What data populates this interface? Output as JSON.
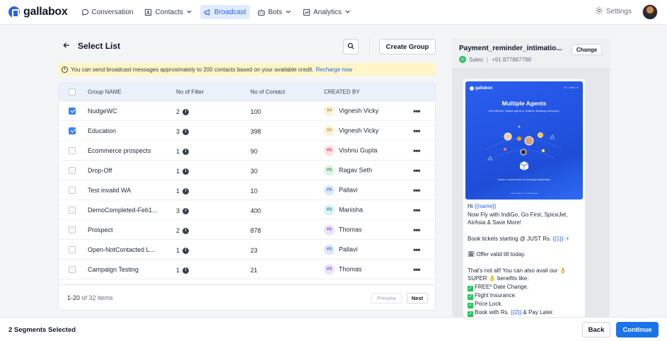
{
  "nav": {
    "logo_text": "gallabox",
    "items": [
      {
        "label": "Conversation",
        "icon": "chat-bubble-icon",
        "active": false,
        "dropdown": false
      },
      {
        "label": "Contacts",
        "icon": "contact-card-icon",
        "active": false,
        "dropdown": true
      },
      {
        "label": "Broadcast",
        "icon": "megaphone-icon",
        "active": true,
        "dropdown": false
      },
      {
        "label": "Bots",
        "icon": "bot-icon",
        "active": false,
        "dropdown": true
      },
      {
        "label": "Analytics",
        "icon": "chart-icon",
        "active": false,
        "dropdown": true
      }
    ],
    "settings_label": "Settings"
  },
  "page": {
    "title": "Select List",
    "create_group_label": "Create Group",
    "notice_text": "You can send broadcast messages approximately to 200 contacts based on your available credit.",
    "notice_link": "Recharge now"
  },
  "table": {
    "headers": {
      "name": "Group NAME",
      "filters": "No of Filter",
      "contacts": "No of Contact",
      "created_by": "CREATED BY"
    },
    "rows": [
      {
        "checked": true,
        "name": "NudgeWC",
        "filters": "2",
        "contacts": "100",
        "initials": "VV",
        "creator": "Vignesh Vicky",
        "badge_bg": "#fdf1d6",
        "badge_fg": "#b7791f"
      },
      {
        "checked": true,
        "name": "Education",
        "filters": "3",
        "contacts": "398",
        "initials": "VV",
        "creator": "Vignesh Vicky",
        "badge_bg": "#fdf1d6",
        "badge_fg": "#b7791f"
      },
      {
        "checked": false,
        "name": "Ecommerce prospects",
        "filters": "1",
        "contacts": "90",
        "initials": "VG",
        "creator": "Vishnu Gupta",
        "badge_bg": "#fde2e4",
        "badge_fg": "#c53030"
      },
      {
        "checked": false,
        "name": "Drop-Off",
        "filters": "1",
        "contacts": "30",
        "initials": "VG",
        "creator": "Ragav Seth",
        "badge_bg": "#dcf5e3",
        "badge_fg": "#2f855a"
      },
      {
        "checked": false,
        "name": "Test invalid WA",
        "filters": "1",
        "contacts": "10",
        "initials": "VG",
        "creator": "Pallavi",
        "badge_bg": "#dde8fb",
        "badge_fg": "#2b6cb0"
      },
      {
        "checked": false,
        "name": "DemoCompleted-Feb1...",
        "filters": "3",
        "contacts": "400",
        "initials": "VG",
        "creator": "Manisha",
        "badge_bg": "#d9f2f7",
        "badge_fg": "#2c7a7b"
      },
      {
        "checked": false,
        "name": "Prospect",
        "filters": "2",
        "contacts": "878",
        "initials": "VG",
        "creator": "Thomas",
        "badge_bg": "#ece3fb",
        "badge_fg": "#6b46c1"
      },
      {
        "checked": false,
        "name": "Open-NotContacted L...",
        "filters": "1",
        "contacts": "23",
        "initials": "VG",
        "creator": "Pallavi",
        "badge_bg": "#dde8fb",
        "badge_fg": "#2b6cb0"
      },
      {
        "checked": false,
        "name": "Campaign Testing",
        "filters": "1",
        "contacts": "21",
        "initials": "VG",
        "creator": "Thomas",
        "badge_bg": "#ece3fb",
        "badge_fg": "#6b46c1"
      }
    ],
    "pager": {
      "range": "1-20",
      "of_text": "of 32 items",
      "prev_label": "Preview",
      "next_label": "Next"
    }
  },
  "template": {
    "name": "Payment_reminder_intimatio...",
    "category": "Sales",
    "phone": "+91 877887788",
    "change_label": "Change",
    "image": {
      "logo_text": "gallabox",
      "nav_text": "1/4 · Invite  >>",
      "title": "Multiple Agents",
      "subtitle": "Add unlimited, multiple agents to Gallabox Whatsapp workspace.",
      "caption": "Create a shared inbox for amazing collaboration",
      "footer": "www.gallabox.com/whatsapp"
    },
    "message": {
      "greet_prefix": "Hi ",
      "var_name": "{{name}}",
      "line_fly": "Now Fly with IndiGo, Go First, SpiceJet, AirAsia & Save More!",
      "book_prefix": "Book tickets starting @ JUST Rs. ",
      "var_1": "{{1}}",
      "book_suffix": " ✈",
      "offer": "🗓 Offer valid till today.",
      "more": "That's not all! You can also avail our 👌 SUPER 👌 benefits like:",
      "b1": "FREE* Date Change.",
      "b2": "Flight Insurance.",
      "b3": "Price Lock.",
      "b4_prefix": "Book with Rs. ",
      "var_2": "{{2}}",
      "b4_suffix": " & Pay Later."
    }
  },
  "footer": {
    "selected_text": "2 Segments Selected",
    "back_label": "Back",
    "continue_label": "Continue"
  },
  "colors": {
    "accent": "#1a73e8",
    "broadcast_active_bg": "#e0ecff",
    "notice_bg": "#fef6c6",
    "table_header_bg": "#eaf1fb"
  }
}
